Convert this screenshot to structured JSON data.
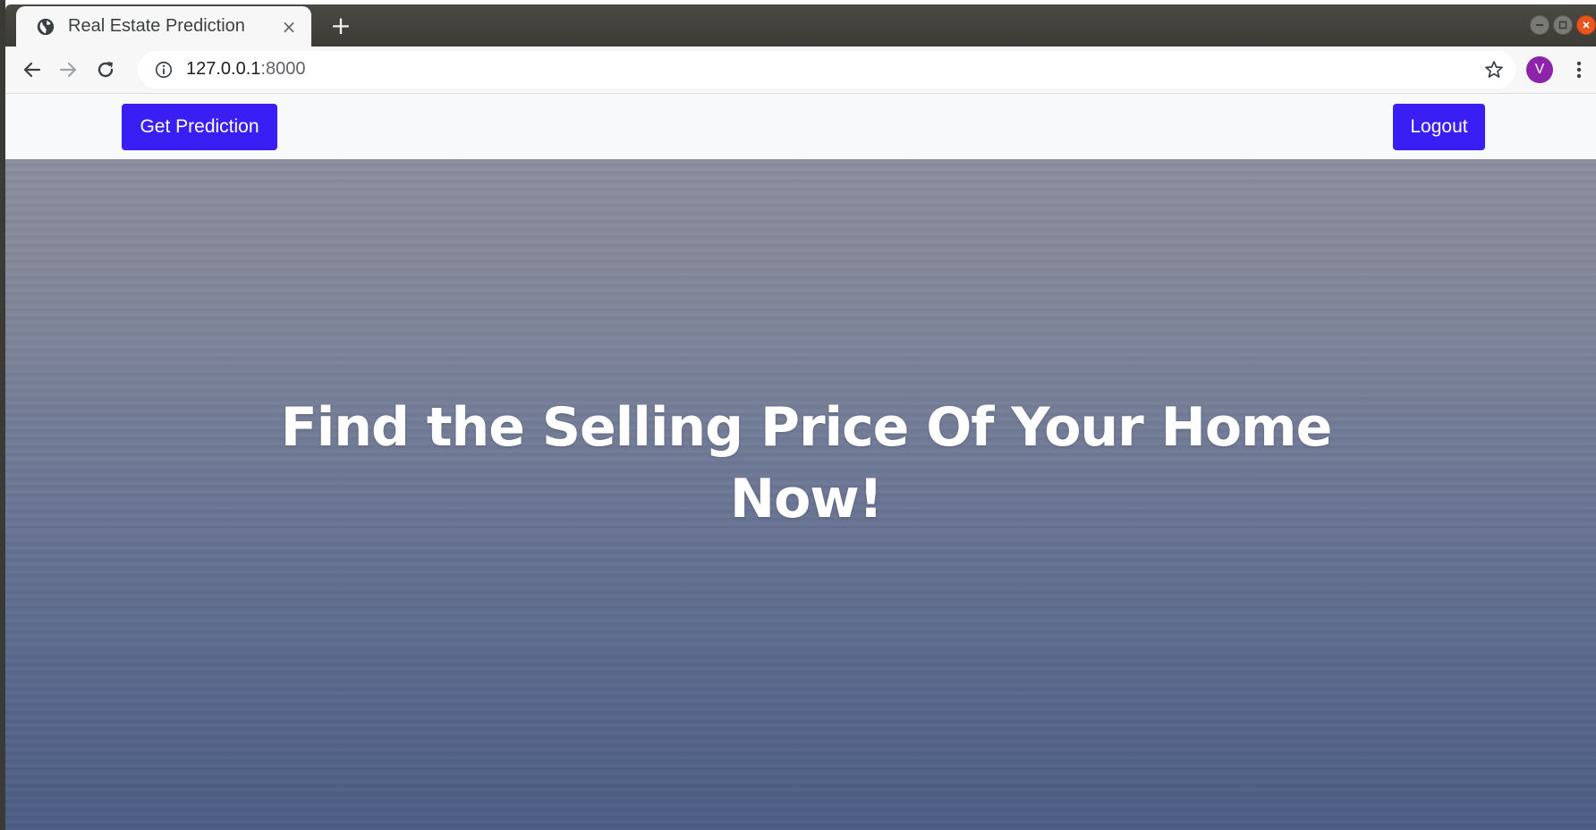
{
  "browser": {
    "tab": {
      "title": "Real Estate Prediction",
      "close_glyph": "×",
      "favicon": "globe-icon"
    },
    "new_tab_glyph": "+",
    "address": {
      "host": "127.0.0.1",
      "port": ":8000"
    },
    "profile_initial": "V",
    "profile_color": "#8e24aa",
    "icons": [
      "back-arrow-icon",
      "forward-arrow-icon",
      "reload-icon",
      "info-icon",
      "star-icon",
      "kebab-menu-icon"
    ]
  },
  "site": {
    "nav": {
      "prediction_label": "Get Prediction",
      "logout_label": "Logout"
    },
    "hero": {
      "headline": "Find the Selling Price Of Your Home Now!"
    },
    "colors": {
      "button": "#3a1ff5",
      "nav_background": "#f8f9fa"
    }
  }
}
